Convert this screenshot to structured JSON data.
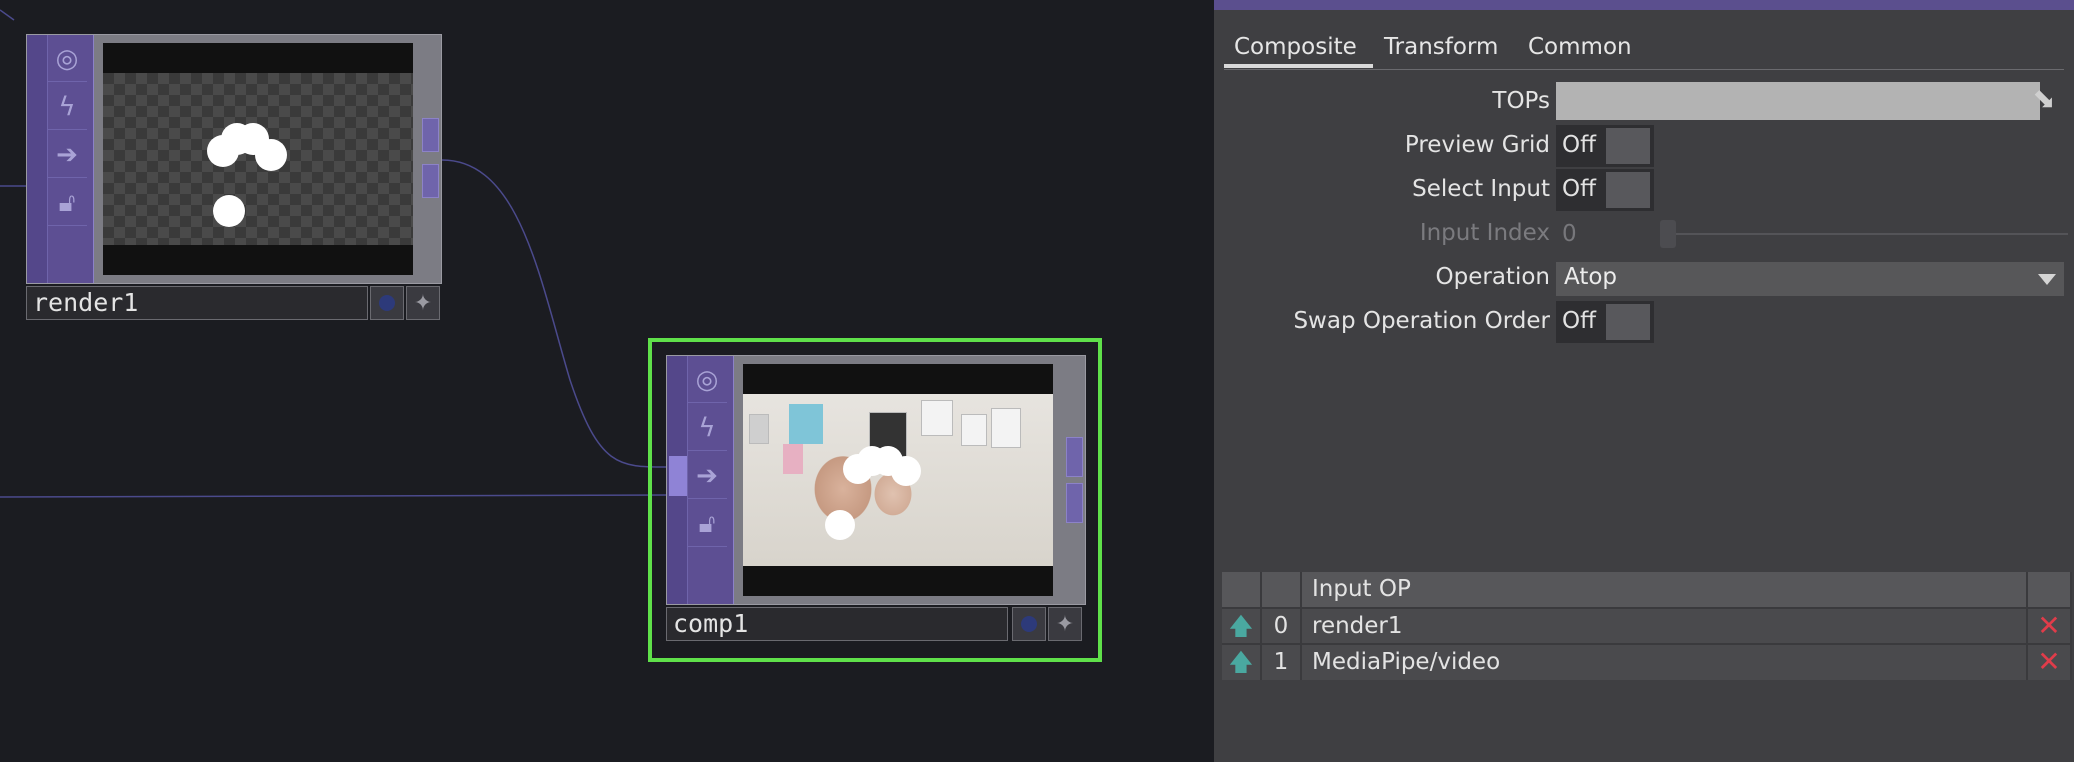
{
  "network": {
    "nodes": [
      {
        "name": "render1",
        "type": "render"
      },
      {
        "name": "comp1",
        "type": "comp",
        "selected": true
      }
    ],
    "icons": [
      "viewer-active-icon",
      "bypass-icon",
      "pass-through-icon",
      "lock-icon"
    ]
  },
  "panel": {
    "tabs": [
      "Composite",
      "Transform",
      "Common"
    ],
    "active_tab": "Composite",
    "params": {
      "tops": {
        "label": "TOPs",
        "value": ""
      },
      "preview_grid": {
        "label": "Preview Grid",
        "value": "Off"
      },
      "select_input": {
        "label": "Select Input",
        "value": "Off"
      },
      "input_index": {
        "label": "Input Index",
        "value": "0",
        "enabled": false
      },
      "operation": {
        "label": "Operation",
        "value": "Atop"
      },
      "swap_operation_order": {
        "label": "Swap Operation Order",
        "value": "Off"
      }
    },
    "input_table": {
      "header": "Input OP",
      "rows": [
        {
          "index": "0",
          "op": "render1"
        },
        {
          "index": "1",
          "op": "MediaPipe/video"
        }
      ]
    }
  },
  "colors": {
    "node_strip": "#5d4f93",
    "selected_outline": "#5fe04a",
    "delete_red": "#e03c4a",
    "up_teal": "#4aa8a0"
  }
}
